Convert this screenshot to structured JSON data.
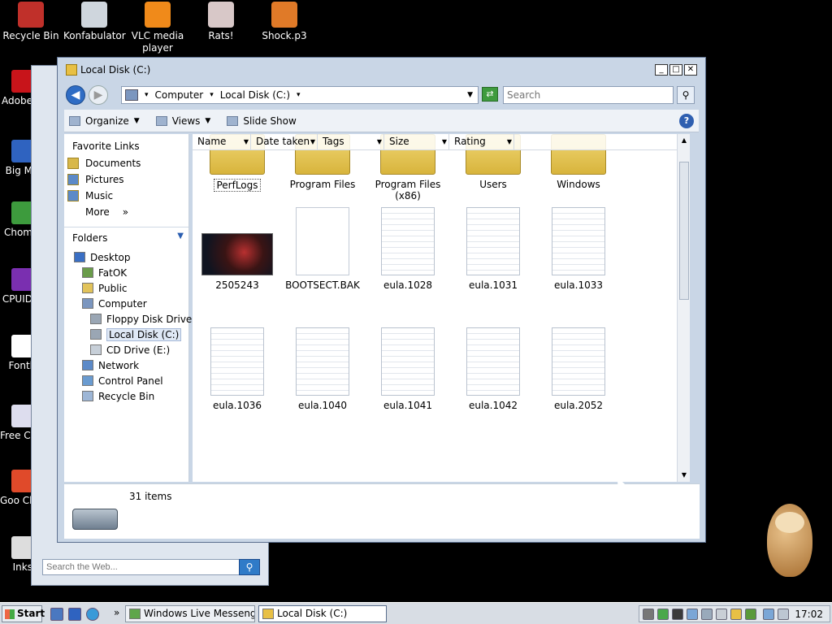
{
  "desktop": {
    "top_icons": [
      {
        "label": "Recycle Bin",
        "icon": "recycle-bin-icon",
        "color": "#c0302a"
      },
      {
        "label": "Konfabulator",
        "icon": "konfabulator-icon",
        "color": "#cfd6dd"
      },
      {
        "label": "VLC media player",
        "icon": "vlc-icon",
        "color": "#f08a1a"
      },
      {
        "label": "Rats!",
        "icon": "rats-icon",
        "color": "#d8c8c8"
      },
      {
        "label": "Shock.p3",
        "icon": "shortcut-icon",
        "color": "#e07a28"
      }
    ],
    "left_icons": [
      {
        "label": "Adobe",
        "icon": "adobe-icon",
        "color": "#c8141a"
      },
      {
        "label": "Big M",
        "icon": "shortcut-icon",
        "color": "#2f63c0"
      },
      {
        "label": "Chom",
        "icon": "chrome-icon",
        "color": "#3d9b3d"
      },
      {
        "label": "CPUID",
        "icon": "cpuid-icon",
        "color": "#7a2fb0"
      },
      {
        "label": "Fontl",
        "icon": "shortcut-icon",
        "color": "#fff"
      },
      {
        "label": "Free Cre",
        "icon": "shortcut-icon",
        "color": "#dde"
      },
      {
        "label": "Goo Chro",
        "icon": "chrome-icon",
        "color": "#e04a2a"
      },
      {
        "label": "Inks",
        "icon": "inkscape-icon",
        "color": "#ddd"
      }
    ]
  },
  "window": {
    "title": "Local Disk (C:)",
    "minimize": "_",
    "maximize": "□",
    "close": "✕",
    "breadcrumb": [
      "Computer",
      "Local Disk (C:)"
    ],
    "search_placeholder": "Search",
    "toolbar": [
      "Organize",
      "Views",
      "Slide Show"
    ],
    "help": "?"
  },
  "nav": {
    "favorite_links_title": "Favorite Links",
    "favorites": [
      "Documents",
      "Pictures",
      "Music",
      "More"
    ],
    "more_chevron": "»",
    "folders_title": "Folders",
    "tree": [
      {
        "label": "Desktop",
        "indent": 0,
        "icon": "desktop-icon",
        "color": "#3a6fc4"
      },
      {
        "label": "FatOK",
        "indent": 1,
        "icon": "user-folder-icon",
        "color": "#6a9c4a"
      },
      {
        "label": "Public",
        "indent": 1,
        "icon": "folder-icon",
        "color": "#e2c35a"
      },
      {
        "label": "Computer",
        "indent": 1,
        "icon": "computer-icon",
        "color": "#7b96bf"
      },
      {
        "label": "Floppy Disk Drive",
        "indent": 2,
        "icon": "floppy-icon",
        "color": "#9aa6b4"
      },
      {
        "label": "Local Disk (C:)",
        "indent": 2,
        "icon": "drive-icon",
        "color": "#9aa6b4",
        "selected": true
      },
      {
        "label": "CD Drive (E:)",
        "indent": 2,
        "icon": "cd-drive-icon",
        "color": "#c7cfd8"
      },
      {
        "label": "Network",
        "indent": 1,
        "icon": "network-icon",
        "color": "#5c8ac8"
      },
      {
        "label": "Control Panel",
        "indent": 1,
        "icon": "control-panel-icon",
        "color": "#6a9bd0"
      },
      {
        "label": "Recycle Bin",
        "indent": 1,
        "icon": "recycle-bin-icon",
        "color": "#9db6d6"
      }
    ]
  },
  "columns": [
    "Name",
    "Date taken",
    "Tags",
    "Size",
    "Rating"
  ],
  "items": [
    {
      "label": "PerfLogs",
      "kind": "folder",
      "selected": true
    },
    {
      "label": "Program Files",
      "kind": "folder"
    },
    {
      "label": "Program Files (x86)",
      "kind": "folder"
    },
    {
      "label": "Users",
      "kind": "folder"
    },
    {
      "label": "Windows",
      "kind": "folder"
    },
    {
      "label": "2505243",
      "kind": "photo"
    },
    {
      "label": "BOOTSECT.BAK",
      "kind": "blank"
    },
    {
      "label": "eula.1028",
      "kind": "doc"
    },
    {
      "label": "eula.1031",
      "kind": "doc"
    },
    {
      "label": "eula.1033",
      "kind": "doc"
    },
    {
      "label": "eula.1036",
      "kind": "doc"
    },
    {
      "label": "eula.1040",
      "kind": "doc"
    },
    {
      "label": "eula.1041",
      "kind": "doc"
    },
    {
      "label": "eula.1042",
      "kind": "doc"
    },
    {
      "label": "eula.2052",
      "kind": "doc"
    }
  ],
  "details": {
    "count": "31 items"
  },
  "bg_search_placeholder": "Search the Web...",
  "taskbar": {
    "start": "Start",
    "more": "»",
    "buttons": [
      {
        "label": "Windows Live Messeng...",
        "active": false
      },
      {
        "label": "Local Disk (C:)",
        "active": true
      }
    ],
    "clock": "17:02"
  }
}
